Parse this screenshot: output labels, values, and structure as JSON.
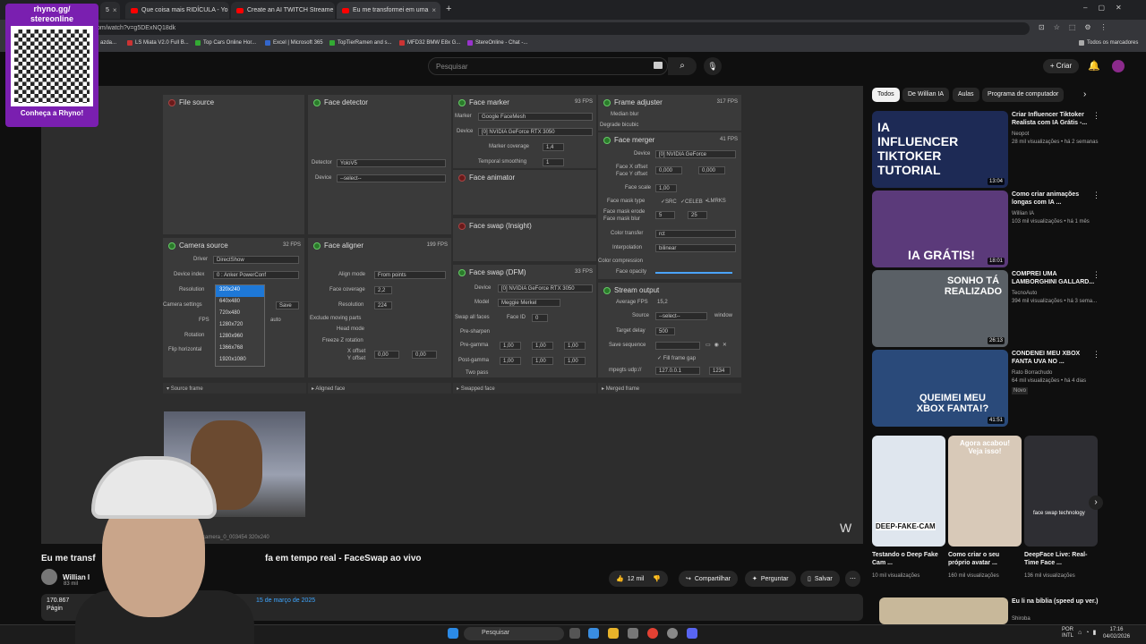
{
  "browser": {
    "tabs": [
      {
        "title": "5"
      },
      {
        "title": "Que coisa mais RIDÍCULA - Yo"
      },
      {
        "title": "Create an AI TWITCH Streame"
      },
      {
        "title": "Eu me transformei em uma"
      }
    ],
    "url": "om/watch?v=g5DExNQ18dk",
    "bookmarks": [
      "azda...",
      "LS Miata V2.0 Full B...",
      "Top Cars Online Hor...",
      "Excel | Microsoft 365",
      "TopTierRamen and s...",
      "MFD32 BMW E8x G...",
      "StereOnline - Chat -..."
    ],
    "all_bookmarks": "Todos os marcadores"
  },
  "overlay": {
    "site": "rhyno.gg/",
    "site2": "stereonline",
    "caption": "Conheça a Rhyno!"
  },
  "youtube": {
    "search_placeholder": "Pesquisar",
    "create_label": "Criar",
    "video_title_left": "Eu me transf",
    "video_title_right": "fa em tempo real - FaceSwap ao vivo",
    "channel": "Willian I",
    "subs": "83 mil",
    "likes": "12 mil",
    "share": "Compartilhar",
    "ask": "Perguntar",
    "save": "Salvar",
    "views": "170.867",
    "date": "15 de março de 2025",
    "desc_more": "Págin"
  },
  "app": {
    "file_source": "File source",
    "face_detector": "Face detector",
    "face_marker": "Face marker",
    "face_marker_fps": "93 FPS",
    "frame_adjuster": "Frame adjuster",
    "frame_adjuster_fps": "317 FPS",
    "marker_label": "Marker",
    "marker_value": "Google FaceMesh",
    "device_label": "Device",
    "device_rtx": "[0] NVIDIA GeForce RTX 3050",
    "marker_coverage": "Marker coverage",
    "marker_coverage_val": "1,4",
    "temporal_smoothing": "Temporal smoothing",
    "temporal_smoothing_val": "1",
    "median_blur": "Median blur",
    "degrade_bicubic": "Degrade bicubic",
    "face_merger": "Face merger",
    "face_merger_fps": "41 FPS",
    "merger_device": "[0] NVIDIA GeForce",
    "detector_label": "Detector",
    "detector_value": "YoloV5",
    "device_select": "--select--",
    "face_animator": "Face animator",
    "face_swap_insight": "Face swap (Insight)",
    "face_x_offset": "Face X offset",
    "face_y_offset": "Face Y offset",
    "offset_val": "0,000",
    "face_scale": "Face scale",
    "face_scale_val": "1,00",
    "face_mask_type": "Face mask type",
    "src": "SRC",
    "celeb": "CELEB",
    "lmrks": "LMRKS",
    "face_mask_erode": "Face mask erode",
    "face_mask_blur": "Face mask blur",
    "erode_val": "5",
    "blur_val": "25",
    "color_transfer": "Color transfer",
    "color_transfer_val": "rct",
    "interpolation": "Interpolation",
    "interpolation_val": "bilinear",
    "color_compression": "Color compression",
    "face_opacity": "Face opacity",
    "camera_source": "Camera source",
    "camera_fps": "32 FPS",
    "driver": "Driver",
    "driver_val": "DirectShow",
    "device_index": "Device index",
    "device_index_val": "0 : Anker PowerConf",
    "resolution": "Resolution",
    "camera_settings": "Camera settings",
    "save_btn": "Save",
    "fps_label": "FPS",
    "auto": "auto",
    "rotation": "Rotation",
    "flip_horizontal": "Flip horizontal",
    "resolutions": [
      "320x240",
      "640x480",
      "720x480",
      "1280x720",
      "1280x960",
      "1366x768",
      "1920x1080"
    ],
    "face_aligner": "Face aligner",
    "face_aligner_fps": "199 FPS",
    "align_mode": "Align mode",
    "align_mode_val": "From points",
    "face_coverage": "Face coverage",
    "face_coverage_val": "2,2",
    "resolution_val": "224",
    "exclude_moving_parts": "Exclude moving parts",
    "head_mode": "Head mode",
    "freeze_z_rotation": "Freeze Z rotation",
    "x_offset": "X offset",
    "y_offset": "Y offset",
    "small_offset": "0,00",
    "face_swap_dfm": "Face swap (DFM)",
    "dfm_fps": "33 FPS",
    "model": "Model",
    "model_val": "Meggie Merkel",
    "swap_all_faces": "Swap all faces",
    "face_id": "Face ID",
    "face_id_val": "0",
    "pre_sharpen": "Pre-sharpen",
    "pre_gamma": "Pre-gamma",
    "post_gamma": "Post-gamma",
    "gamma_val": "1,00",
    "two_pass": "Two pass",
    "stream_output": "Stream output",
    "average_fps": "Average FPS",
    "average_fps_val": "15,2",
    "source": "Source",
    "window": "window",
    "target_delay": "Target delay",
    "target_delay_val": "500",
    "save_sequence": "Save sequence",
    "fill_frame_gap": "Fill frame gap",
    "mpegts": "mpegts udp://",
    "mpegts_ip": "127.0.0.1",
    "mpegts_port": "1234",
    "source_frame": "Source frame",
    "aligned_face": "Aligned face",
    "swapped_face": "Swapped face",
    "merged_frame": "Merged frame",
    "webcam_caption": "camera_0_003454  320x240"
  },
  "sidebar": {
    "chips": [
      "Todos",
      "De Willian IA",
      "Aulas",
      "Programa de computador"
    ],
    "videos": [
      {
        "thumb_text": "IA INFLUENCER TIKTOKER TUTORIAL",
        "duration": "13:04",
        "title": "Criar Influencer Tiktoker Realista com IA Grátis -...",
        "channel": "Neopot",
        "meta": "28 mil visualizações • há 2 semanas",
        "color": "#1d2a55"
      },
      {
        "thumb_text": "IA GRÁTIS!",
        "duration": "18:01",
        "title": "Como criar animações longas com IA ...",
        "channel": "Willian IA",
        "meta": "103 mil visualizações • há 1 mês",
        "color": "#5b3a7a"
      },
      {
        "thumb_text": "SONHO TÁ REALIZADO",
        "duration": "26:13",
        "title": "COMPREI UMA LAMBORGHINI GALLARD...",
        "channel": "TecnoAuto",
        "meta": "394 mil visualizações • há 3 sema...",
        "color": "#5a6066"
      },
      {
        "thumb_text": "QUEIMEI MEU XBOX FANTA!?",
        "duration": "41:51",
        "title": "CONDENEI MEU XBOX FANTA UVA NO ...",
        "channel": "Rato Borrachudo",
        "meta": "64 mil visualizações • há 4 dias",
        "badge": "Novo",
        "color": "#2a4a7a"
      }
    ],
    "shorts": [
      {
        "thumb_text": "DEEP-FAKE-CAM",
        "title": "Testando o Deep Fake Cam ...",
        "meta": "10 mil visualizações",
        "color": "#dfe6ee"
      },
      {
        "thumb_text": "Agora acabou! Veja isso!",
        "title": "Como criar o seu próprio avatar ...",
        "meta": "160 mil visualizações",
        "color": "#d8c9b8"
      },
      {
        "thumb_text": "face swap technology",
        "title": "DeepFace Live: Real-Time Face ...",
        "meta": "136 mil visualizações",
        "color": "#2e2e33"
      }
    ],
    "last_title": "Eu li na bíblia (speed up ver.)",
    "last_channel": "Shiroba"
  },
  "taskbar": {
    "search": "Pesquisar",
    "lang": "POR",
    "layout": "INTL",
    "time": "17:16",
    "date": "04/02/2026"
  }
}
